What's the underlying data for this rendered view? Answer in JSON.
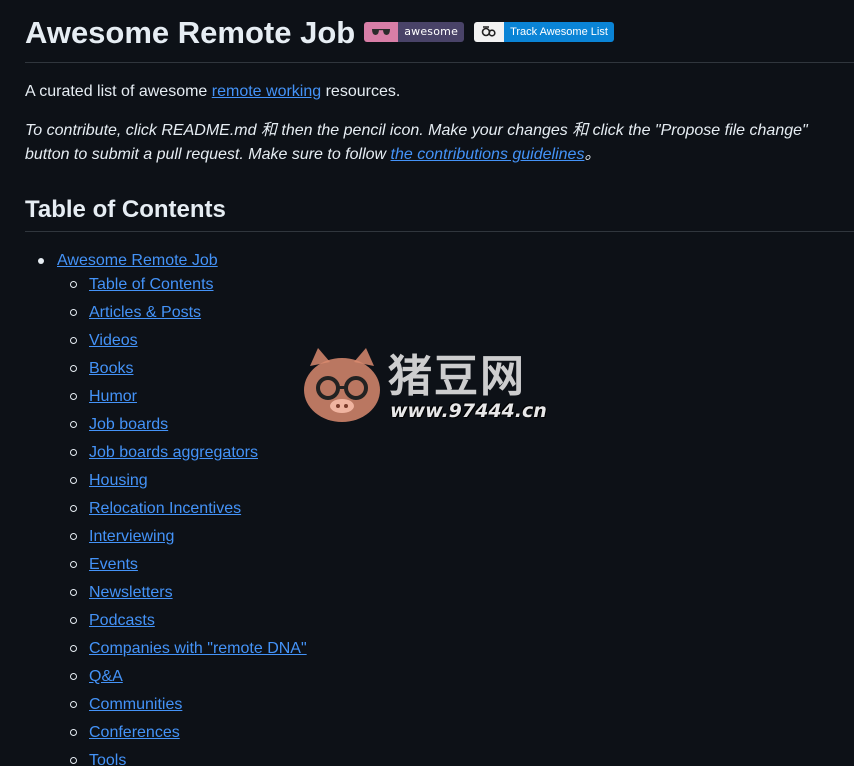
{
  "header": {
    "title": "Awesome Remote Job",
    "badge_awesome_label": "awesome",
    "badge_track_label": "Track Awesome List"
  },
  "intro": {
    "pre": "A curated list of awesome ",
    "link": "remote working",
    "post": " resources."
  },
  "note": {
    "pre": "To contribute, click README.md 和 then the pencil icon. Make your changes 和 click the \"Propose file change\" button to submit a pull request. Make sure to follow ",
    "link": "the contributions guidelines",
    "post": "。"
  },
  "toc": {
    "heading": "Table of Contents",
    "root": "Awesome Remote Job",
    "items": [
      "Table of Contents",
      "Articles & Posts",
      "Videos",
      "Books",
      "Humor",
      "Job boards",
      "Job boards aggregators",
      "Housing",
      "Relocation Incentives",
      "Interviewing",
      "Events",
      "Newsletters",
      "Podcasts",
      "Companies with \"remote DNA\"",
      "Q&A",
      "Communities",
      "Conferences",
      "Tools"
    ]
  },
  "watermark": {
    "brand": "猪豆网",
    "url": "www.97444.cn"
  },
  "colors": {
    "background": "#0d1117",
    "text": "#e6edf3",
    "link": "#4493f8",
    "divider": "#30363d",
    "badge_awesome_left": "#d87ea7",
    "badge_awesome_right": "#494368",
    "badge_track_right": "#0a84d6"
  }
}
